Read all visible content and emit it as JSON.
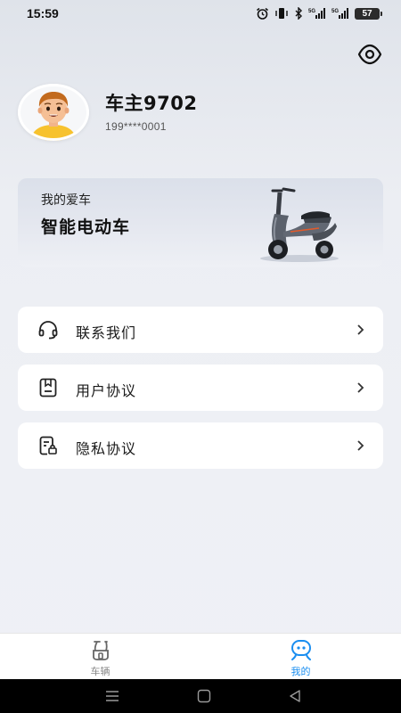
{
  "status_bar": {
    "time": "15:59",
    "battery": "57",
    "icons": [
      "alarm-icon",
      "vibrate-icon",
      "bluetooth-icon",
      "signal-5g-icon",
      "signal-5g-icon",
      "battery-icon"
    ]
  },
  "header": {
    "toggle_icon": "eye-icon"
  },
  "profile": {
    "username": "车主9702",
    "phone": "199****0001"
  },
  "vehicle_card": {
    "label": "我的爱车",
    "name": "智能电动车"
  },
  "menu": {
    "items": [
      {
        "label": "联系我们",
        "icon": "headset-icon"
      },
      {
        "label": "用户协议",
        "icon": "document-icon"
      },
      {
        "label": "隐私协议",
        "icon": "privacy-document-icon"
      }
    ]
  },
  "tab_bar": {
    "tabs": [
      {
        "label": "车辆",
        "icon": "scooter-icon",
        "active": false
      },
      {
        "label": "我的",
        "icon": "mine-icon",
        "active": true
      }
    ],
    "active_color": "#1a8ef0",
    "inactive_color": "#888888"
  },
  "nav_bar": {
    "buttons": [
      "menu-icon",
      "home-icon",
      "back-icon"
    ]
  }
}
